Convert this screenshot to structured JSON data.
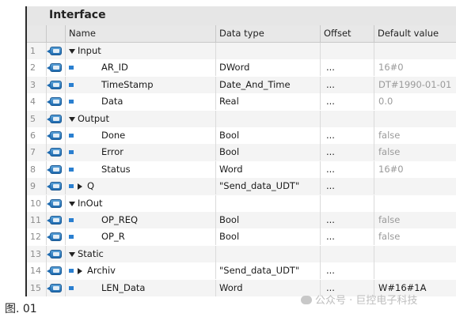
{
  "panel": {
    "title": "Interface",
    "columns": {
      "name": "Name",
      "data_type": "Data type",
      "offset": "Offset",
      "default_value": "Default value"
    }
  },
  "rows": [
    {
      "num": "1",
      "kind": "section",
      "expand": "down",
      "name": "Input",
      "type": "",
      "offset": "",
      "default": ""
    },
    {
      "num": "2",
      "kind": "item",
      "expand": "",
      "name": "AR_ID",
      "type": "DWord",
      "offset": "...",
      "default": "16#0"
    },
    {
      "num": "3",
      "kind": "item",
      "expand": "",
      "name": "TimeStamp",
      "type": "Date_And_Time",
      "offset": "...",
      "default": "DT#1990-01-01"
    },
    {
      "num": "4",
      "kind": "item",
      "expand": "",
      "name": "Data",
      "type": "Real",
      "offset": "...",
      "default": "0.0"
    },
    {
      "num": "5",
      "kind": "section",
      "expand": "down",
      "name": "Output",
      "type": "",
      "offset": "",
      "default": ""
    },
    {
      "num": "6",
      "kind": "item",
      "expand": "",
      "name": "Done",
      "type": "Bool",
      "offset": "...",
      "default": "false"
    },
    {
      "num": "7",
      "kind": "item",
      "expand": "",
      "name": "Error",
      "type": "Bool",
      "offset": "...",
      "default": "false"
    },
    {
      "num": "8",
      "kind": "item",
      "expand": "",
      "name": "Status",
      "type": "Word",
      "offset": "...",
      "default": "16#0"
    },
    {
      "num": "9",
      "kind": "struct",
      "expand": "right",
      "name": "Q",
      "type": "\"Send_data_UDT\"",
      "offset": "...",
      "default": ""
    },
    {
      "num": "10",
      "kind": "section",
      "expand": "down",
      "name": "InOut",
      "type": "",
      "offset": "",
      "default": ""
    },
    {
      "num": "11",
      "kind": "item",
      "expand": "",
      "name": "OP_REQ",
      "type": "Bool",
      "offset": "...",
      "default": "false"
    },
    {
      "num": "12",
      "kind": "item",
      "expand": "",
      "name": "OP_R",
      "type": "Bool",
      "offset": "...",
      "default": "false"
    },
    {
      "num": "13",
      "kind": "section",
      "expand": "down",
      "name": "Static",
      "type": "",
      "offset": "",
      "default": ""
    },
    {
      "num": "14",
      "kind": "struct",
      "expand": "right",
      "name": "Archiv",
      "type": "\"Send_data_UDT\"",
      "offset": "...",
      "default": ""
    },
    {
      "num": "15",
      "kind": "item",
      "expand": "",
      "name": "LEN_Data",
      "type": "Word",
      "offset": "...",
      "default": "W#16#1A"
    }
  ],
  "caption": "图. 01",
  "watermark": "公众号 · 巨控电子科技"
}
